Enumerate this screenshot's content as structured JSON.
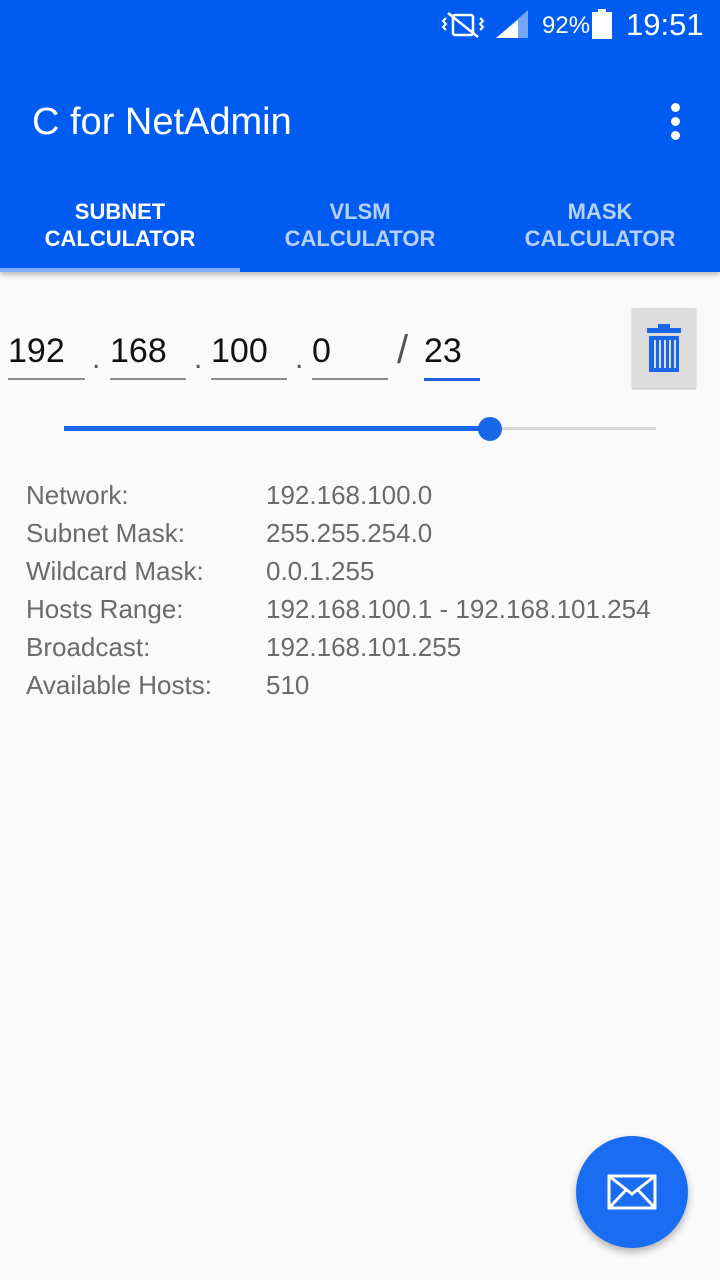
{
  "status_bar": {
    "battery_percent": "92%",
    "time": "19:51",
    "icons": [
      "vibrate-mute-icon",
      "signal-icon",
      "battery-icon"
    ]
  },
  "app_bar": {
    "title": "C for NetAdmin",
    "menu_icon": "more-vert-icon"
  },
  "tabs": [
    {
      "line1": "SUBNET",
      "line2": "CALCULATOR",
      "active": true
    },
    {
      "line1": "VLSM",
      "line2": "CALCULATOR",
      "active": false
    },
    {
      "line1": "MASK",
      "line2": "CALCULATOR",
      "active": false
    }
  ],
  "ip_input": {
    "octet1": "192",
    "octet2": "168",
    "octet3": "100",
    "octet4": "0",
    "separator": ".",
    "prefix_separator": "/",
    "prefix": "23"
  },
  "delete_button": {
    "icon": "trash-icon"
  },
  "slider": {
    "value": 23,
    "min": 0,
    "max": 32
  },
  "results": [
    {
      "label": "Network:",
      "value": "192.168.100.0"
    },
    {
      "label": "Subnet Mask:",
      "value": "255.255.254.0"
    },
    {
      "label": "Wildcard Mask:",
      "value": "0.0.1.255"
    },
    {
      "label": "Hosts Range:",
      "value": "192.168.100.1 - 192.168.101.254"
    },
    {
      "label": "Broadcast:",
      "value": "192.168.101.255"
    },
    {
      "label": "Available Hosts:",
      "value": "510"
    }
  ],
  "fab": {
    "icon": "mail-icon"
  },
  "colors": {
    "primary": "#005cf0",
    "accent": "#1a66e8",
    "background": "#fafafa",
    "result_text": "#6b6b6b"
  }
}
